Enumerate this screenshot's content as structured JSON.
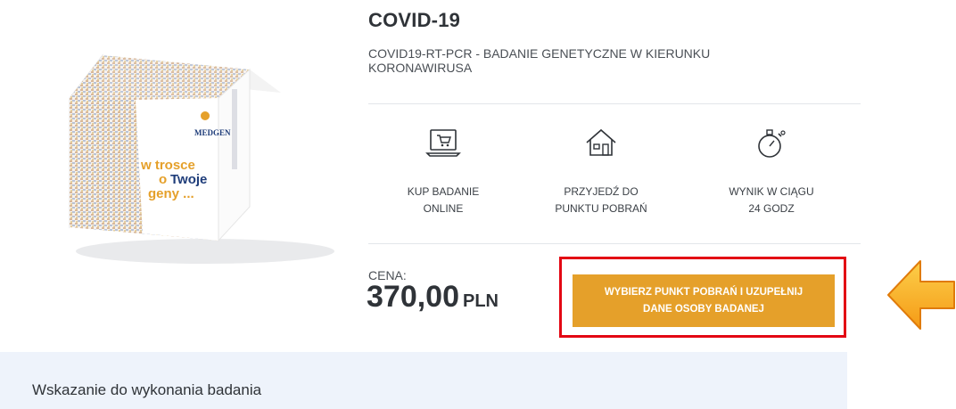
{
  "product": {
    "title": "COVID-19",
    "subtitle": "COVID19-RT-PCR - BADANIE GENETYCZNE W KIERUNKU KORONAWIRUSA",
    "box": {
      "brand": "MEDGEN",
      "slogan_1": "w trosce",
      "slogan_2a": "o",
      "slogan_2b": "Twoje",
      "slogan_3": "geny ..."
    }
  },
  "steps": [
    {
      "icon": "laptop-cart-icon",
      "label_1": "KUP BADANIE",
      "label_2": "ONLINE"
    },
    {
      "icon": "house-icon",
      "label_1": "PRZYJEDŹ DO",
      "label_2": "PUNKTU POBRAŃ"
    },
    {
      "icon": "stopwatch-icon",
      "label_1": "WYNIK W CIĄGU",
      "label_2": "24 GODZ"
    }
  ],
  "price": {
    "label": "CENA:",
    "value": "370,00",
    "currency": "PLN"
  },
  "cta": {
    "line_1": "WYBIERZ PUNKT POBRAŃ I UZUPEŁNIJ",
    "line_2": "DANE OSOBY BADANEJ"
  },
  "annotation": {
    "highlight_color": "#e30613",
    "arrow_color": "#f5a623"
  },
  "accordion": {
    "indication_label": "Wskazanie do wykonania badania"
  },
  "colors": {
    "accent": "#e5a02a",
    "panel_bg": "#eef3fb"
  }
}
